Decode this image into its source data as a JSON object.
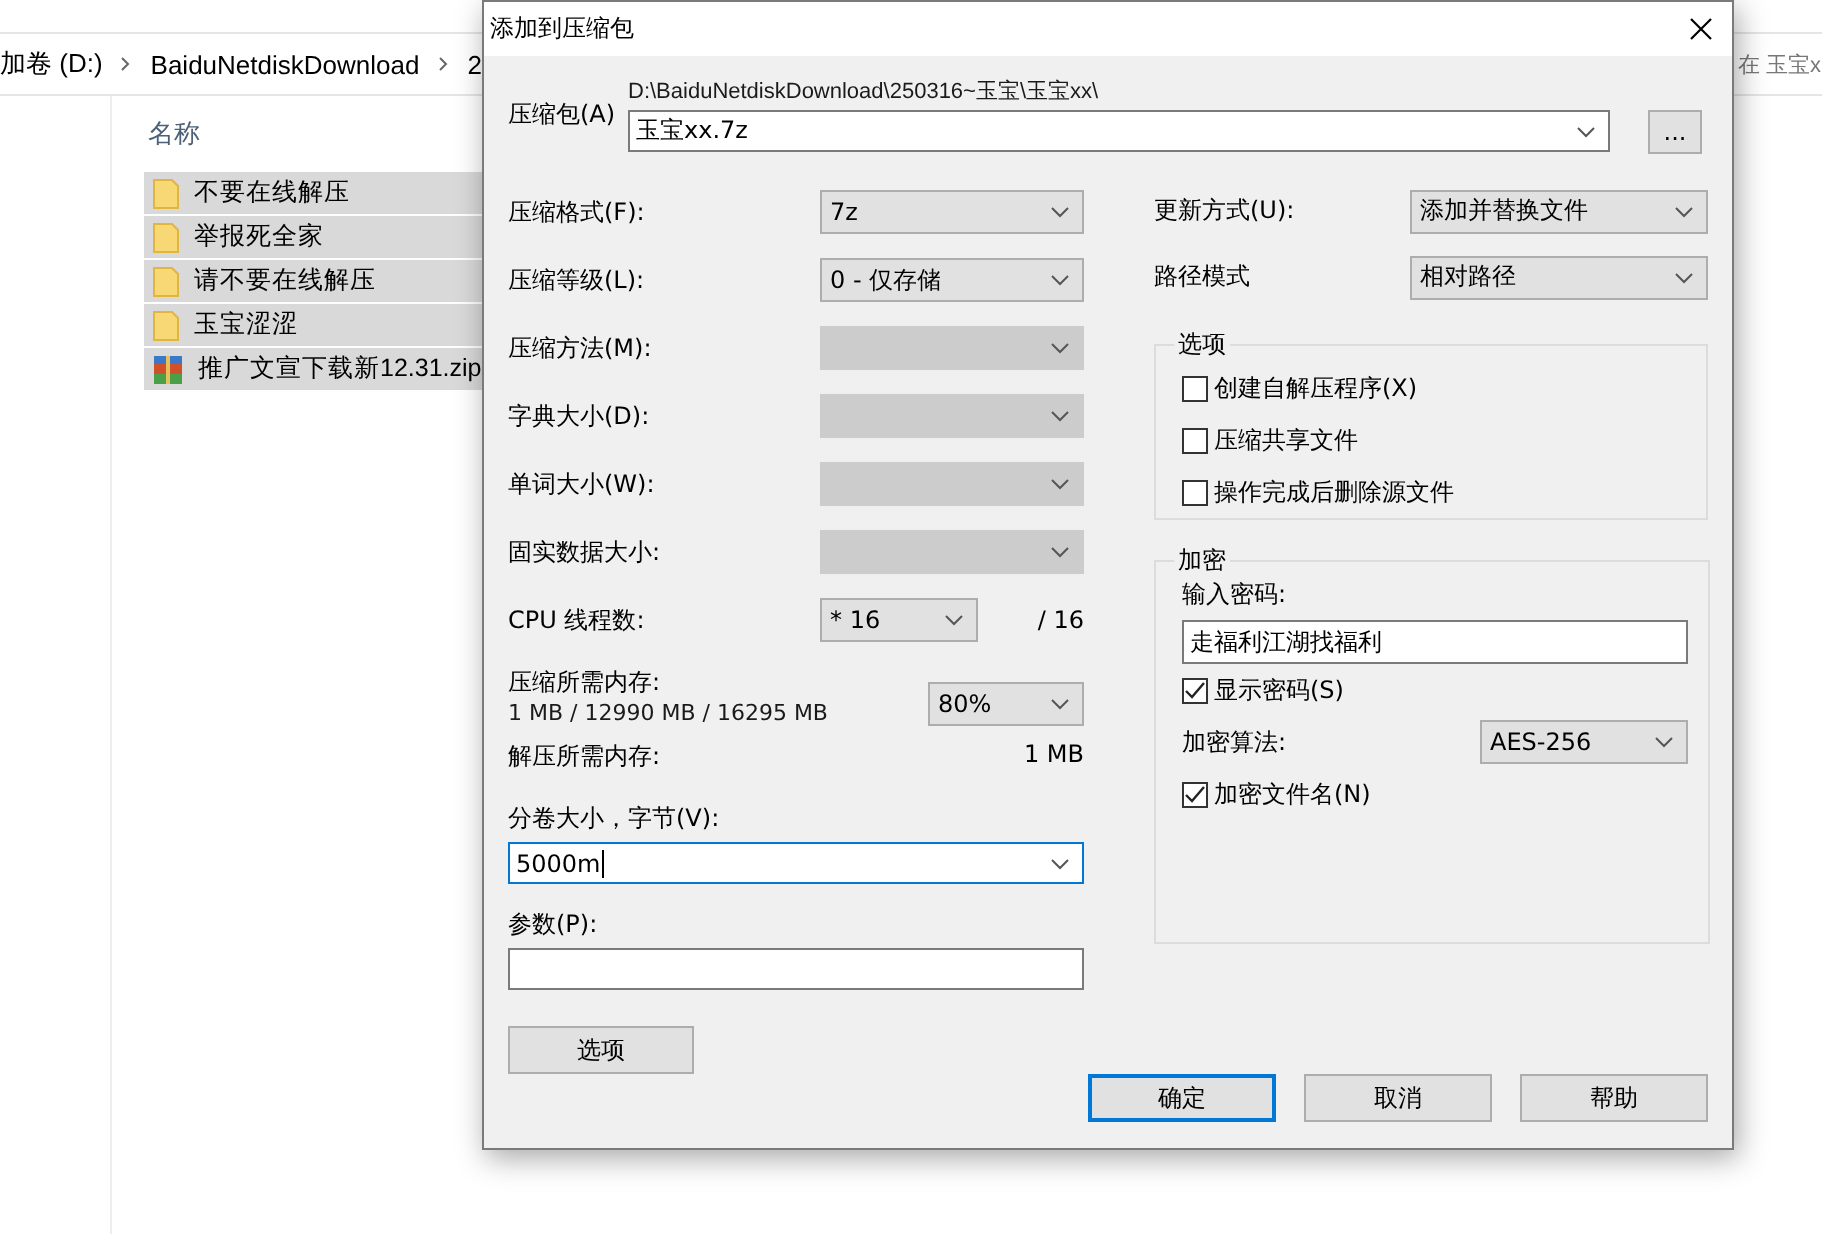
{
  "explorer": {
    "breadcrumb": [
      "加卷 (D:)",
      "BaiduNetdiskDownload",
      "2"
    ],
    "search_placeholder": "在 玉宝x",
    "column_header": "名称",
    "files": [
      {
        "name": "不要在线解压",
        "kind": "folder",
        "selected": true
      },
      {
        "name": "举报死全家",
        "kind": "folder",
        "selected": true
      },
      {
        "name": "请不要在线解压",
        "kind": "folder",
        "selected": true
      },
      {
        "name": "玉宝涩涩",
        "kind": "folder",
        "selected": true
      },
      {
        "name": "推广文宣下载新12.31.zip",
        "kind": "archive",
        "selected": true
      }
    ]
  },
  "dialog": {
    "title": "添加到压缩包",
    "archive": {
      "label": "压缩包(A)",
      "path": "D:\\BaiduNetdiskDownload\\250316~玉宝\\玉宝xx\\",
      "value": "玉宝xx.7z",
      "browse": "..."
    },
    "left_fields": [
      {
        "label": "压缩格式(F):",
        "value": "7z",
        "disabled": false
      },
      {
        "label": "压缩等级(L):",
        "value": "0 - 仅存储",
        "disabled": false
      },
      {
        "label": "压缩方法(M):",
        "disabled": true
      },
      {
        "label": "字典大小(D):",
        "disabled": true
      },
      {
        "label": "单词大小(W):",
        "disabled": true
      },
      {
        "label": "固实数据大小:",
        "disabled": true
      },
      {
        "label": "CPU 线程数:",
        "value": "* 16",
        "disabled": false,
        "suffix": "/ 16"
      }
    ],
    "memory": {
      "compress_label": "压缩所需内存:",
      "compress_value": "1 MB / 12990 MB / 16295 MB",
      "percent": "80%",
      "decompress_label": "解压所需内存:",
      "decompress_value": "1 MB"
    },
    "volume": {
      "label": "分卷大小，字节(V):",
      "value": "5000m"
    },
    "params": {
      "label": "参数(P):"
    },
    "options_button": "选项",
    "right_fields": [
      {
        "label": "更新方式(U):",
        "value": "添加并替换文件"
      },
      {
        "label": "路径模式",
        "value": "相对路径"
      }
    ],
    "options": {
      "title": "选项",
      "items": [
        {
          "label": "创建自解压程序(X)",
          "checked": false
        },
        {
          "label": "压缩共享文件",
          "checked": false
        },
        {
          "label": "操作完成后删除源文件",
          "checked": false
        }
      ]
    },
    "encryption": {
      "title": "加密",
      "password_label": "输入密码:",
      "password": "走福利江湖找福利",
      "show_password": {
        "label": "显示密码(S)",
        "checked": true
      },
      "method_label": "加密算法:",
      "method": "AES-256",
      "encrypt_names": {
        "label": "加密文件名(N)",
        "checked": true
      }
    },
    "buttons": [
      {
        "label": "确定",
        "default": true
      },
      {
        "label": "取消",
        "default": false
      },
      {
        "label": "帮助",
        "default": false
      }
    ]
  }
}
